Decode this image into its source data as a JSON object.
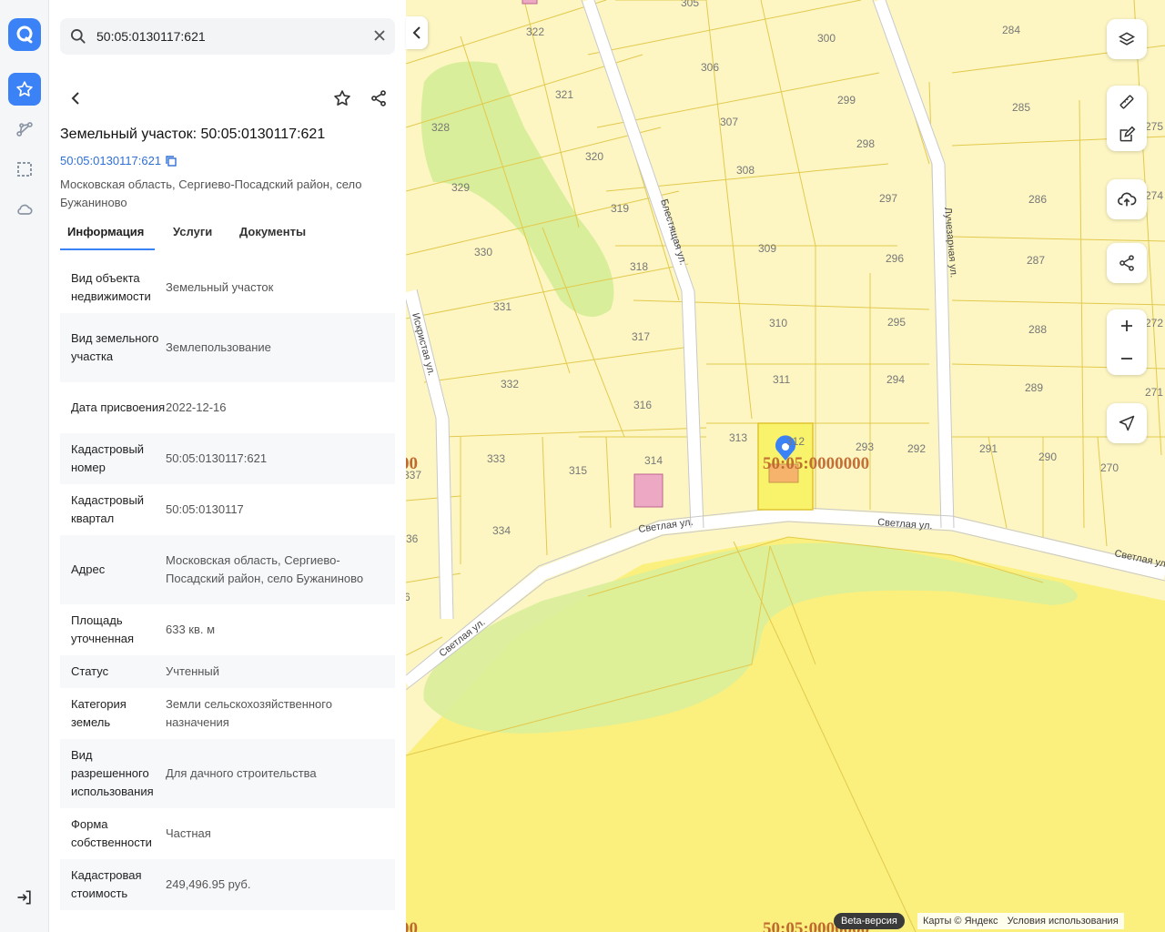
{
  "rail": {
    "logo_icon": "app-logo-icon",
    "items": [
      {
        "name": "favorites",
        "icon": "star-icon",
        "active": true
      },
      {
        "name": "routes",
        "icon": "route-icon"
      },
      {
        "name": "selection",
        "icon": "dashed-square-icon"
      },
      {
        "name": "cloud",
        "icon": "cloud-icon"
      }
    ],
    "logout_icon": "logout-icon"
  },
  "search": {
    "value": "50:05:0130117:621"
  },
  "panel": {
    "title": "Земельный участок: 50:05:0130117:621",
    "cad_link": "50:05:0130117:621",
    "address": "Московская область, Сергиево-Посадский район, село Бужаниново",
    "tabs": [
      {
        "label": "Информация"
      },
      {
        "label": "Услуги"
      },
      {
        "label": "Документы"
      }
    ],
    "rows": [
      {
        "k": "Вид объекта недвижимости",
        "v": "Земельный участок"
      },
      {
        "k": "Вид земельного участка",
        "v": "Землепользование"
      },
      {
        "k": "Дата присвоения",
        "v": "2022-12-16"
      },
      {
        "k": "Кадастровый номер",
        "v": "50:05:0130117:621"
      },
      {
        "k": "Кадастровый квартал",
        "v": "50:05:0130117"
      },
      {
        "k": "Адрес",
        "v": "Московская область, Сергиево-Посадский район, село Бужаниново"
      },
      {
        "k": "Площадь уточненная",
        "v": "633 кв. м"
      },
      {
        "k": "Статус",
        "v": "Учтенный"
      },
      {
        "k": "Категория земель",
        "v": "Земли сельскохозяйственного назначения"
      },
      {
        "k": "Вид разрешенного использования",
        "v": "Для дачного строительства"
      },
      {
        "k": "Форма собственности",
        "v": "Частная"
      },
      {
        "k": "Кадастровая стоимость",
        "v": "249,496.95 руб."
      }
    ]
  },
  "map": {
    "streets": [
      "Блестящая ул.",
      "Лучезарная ул.",
      "Искристая ул.",
      "Светлая ул.",
      "Светлая ул.",
      "Светлая ул.",
      "Светлая ул."
    ],
    "quarter_labels": [
      "50:05:0000000",
      "50:05:0000000",
      "00",
      "00"
    ],
    "plots": [
      "322",
      "300",
      "284",
      "305",
      "306",
      "299",
      "285",
      "321",
      "328",
      "307",
      "298",
      "275",
      "320",
      "308",
      "329",
      "297",
      "286",
      "274",
      "319",
      "309",
      "296",
      "287",
      "330",
      "318",
      "310",
      "295",
      "288",
      "272",
      "331",
      "317",
      "311",
      "294",
      "289",
      "271",
      "332",
      "316",
      "313",
      "312",
      "293",
      "292",
      "291",
      "290",
      "270",
      "333",
      "315",
      "314",
      "334",
      "337",
      "36",
      "6"
    ],
    "beta": "Beta-версия",
    "attribution": "Карты © Яндекс",
    "terms": "Условия использования"
  },
  "colors": {
    "accent": "#3b82f6",
    "plot_fill": "#fdf6c3",
    "plot_line": "#e2c94c",
    "forest": "#d9ee9a",
    "selected": "#f8f36a"
  }
}
